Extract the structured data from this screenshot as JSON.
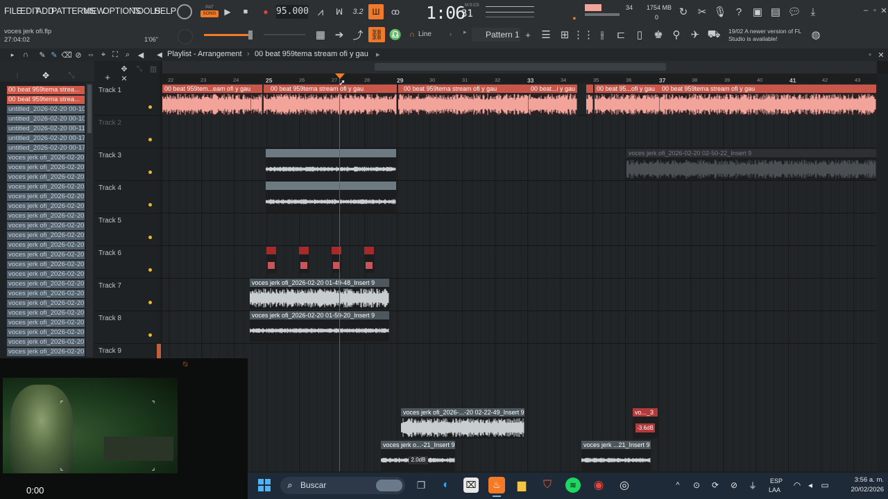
{
  "menu": [
    "FILE",
    "EDIT",
    "ADD",
    "PATTERNS",
    "VIEW",
    "OPTIONS",
    "TOOLS",
    "HELP"
  ],
  "mode": {
    "pat": "PAT",
    "song": "SONG"
  },
  "tempo": "95.000",
  "time": {
    "main": "1:06",
    "sub": "31",
    "unit": "M:S:CS"
  },
  "cpu": {
    "voices": "34",
    "memory": "1754 MB",
    "polyphony": "0"
  },
  "project": {
    "name": "voces jerk ofi.flp",
    "time": "27:04:02",
    "position": "1'06\""
  },
  "snap": "Line",
  "pattern": "Pattern 1",
  "update": {
    "date": "19/02",
    "message": "A newer version of FL Studio is available!"
  },
  "playlist": {
    "title": "Playlist - Arrangement",
    "breadcrumb": "00 beat 959tema stream ofi y gau"
  },
  "ruler": [
    "22",
    "23",
    "24",
    "25",
    "26",
    "27",
    "28",
    "29",
    "30",
    "31",
    "32",
    "33",
    "34",
    "35",
    "36",
    "37",
    "38",
    "39",
    "40",
    "41",
    "42",
    "43"
  ],
  "picker": [
    "00 beat 959tema strea...",
    "00 beat 959tema strea...",
    "untitled_2026-02-20 00-10...",
    "untitled_2026-02-20 00-10...",
    "untitled_2026-02-20 00-11...",
    "untitled_2026-02-20 00-17...",
    "untitled_2026-02-20 00-17...",
    "voces jerk ofi_2026-02-20...",
    "voces jerk ofi_2026-02-20...",
    "voces jerk ofi_2026-02-20...",
    "voces jerk ofi_2026-02-20...",
    "voces jerk ofi_2026-02-20...",
    "voces jerk ofi_2026-02-20...",
    "voces jerk ofi_2026-02-20...",
    "voces jerk ofi_2026-02-20...",
    "voces jerk ofi_2026-02-20...",
    "voces jerk ofi_2026-02-20...",
    "voces jerk ofi_2026-02-20...",
    "voces jerk ofi_2026-02-20...",
    "voces jerk ofi_2026-02-20...",
    "voces jerk ofi_2026-02-20...",
    "voces jerk ofi_2026-02-20...",
    "voces jerk ofi_2026-02-20...",
    "voces jerk ofi_2026-02-20...",
    "voces jerk ofi_2026-02-20...",
    "voces jerk ofi_2026-02-20...",
    "voces jerk ofi_2026-02-20...",
    "voces jerk ofi_2026-02-20..."
  ],
  "tracks": [
    "Track 1",
    "Track 2",
    "Track 3",
    "Track 4",
    "Track 5",
    "Track 6",
    "Track 7",
    "Track 8",
    "Track 9"
  ],
  "clips": {
    "t1a": "00 beat 959tem...eam ofi y gau",
    "t1b": "00 beat 959tema stream ofi y gau",
    "t1c": "00 beat 959tema stream ofi y gau",
    "t1d": "00 beat...i y gau",
    "t1e": "00 beat 95...ofi y gau",
    "t1f": "00 beat 959tema stream ofi y gau",
    "t3": "voces jerk ofi_2026-02-20 02-50-22_Insert 9",
    "t7": "voces jerk ofi_2026-02-20 01-49-48_Insert 9",
    "t8": "voces jerk ofi_2026-02-20 01-59-20_Insert 9",
    "b1": "voces jerk ofi_2026-...-20 02-22-49_Insert 9",
    "b2": "vo..._3",
    "b3": "voces jerk o...-21_Insert 9",
    "b4": "voces jerk ...21_Insert 9",
    "gain1": "-3.6dB",
    "gain2": "2.0dB"
  },
  "webcam": {
    "timer": "0:00"
  },
  "taskbar": {
    "search": "Buscar",
    "lang": "ESP",
    "layout": "LAA",
    "clock": "3:56 a. m.",
    "date": "20/02/2026"
  },
  "colors": {
    "accent": "#f47a25",
    "audio_clip": "#f2a49a",
    "clip_header": "#c8574a",
    "pattern_clip": "#6d7a82"
  }
}
